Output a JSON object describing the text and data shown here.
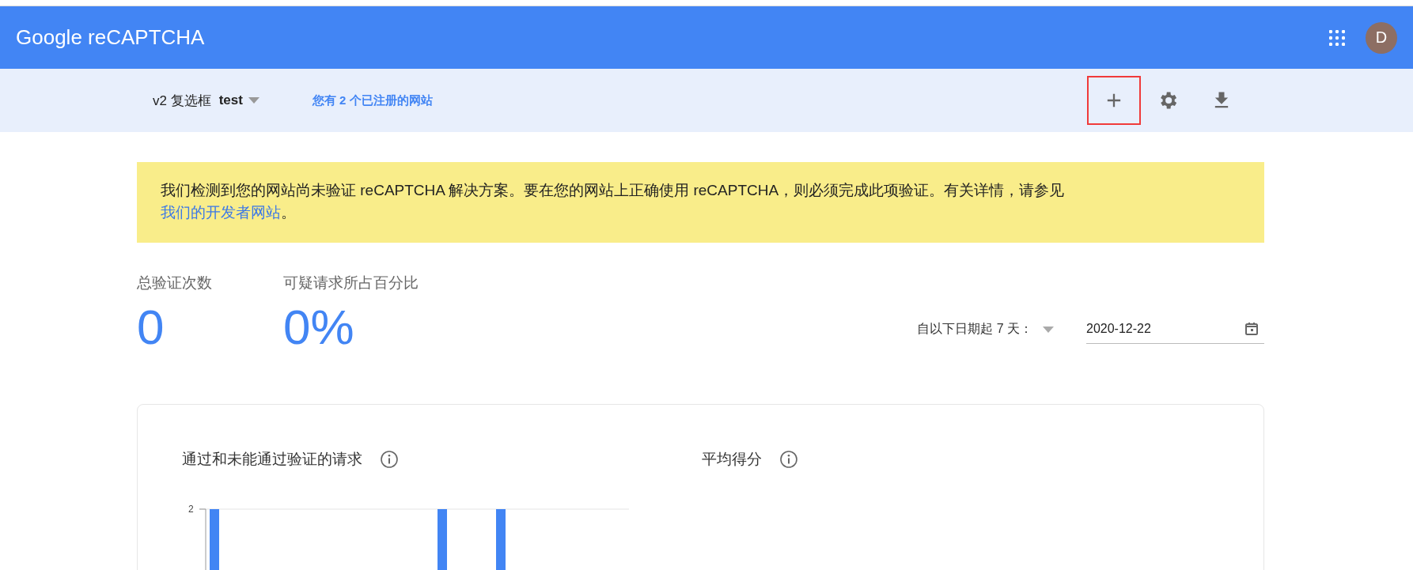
{
  "header": {
    "title": "Google reCAPTCHA",
    "avatar_letter": "D"
  },
  "subheader": {
    "key_type": "v2 复选框",
    "site": "test",
    "sites_link": "您有 2 个已注册的网站",
    "actions": [
      {
        "kind": "add",
        "highlighted": true
      },
      {
        "kind": "settings",
        "highlighted": false
      },
      {
        "kind": "download",
        "highlighted": false
      }
    ]
  },
  "banner": {
    "text": "我们检测到您的网站尚未验证 reCAPTCHA 解决方案。要在您的网站上正确使用 reCAPTCHA，则必须完成此项验证。有关详情，请参见",
    "link": "我们的开发者网站",
    "end": "。"
  },
  "stats": [
    {
      "label": "总验证次数",
      "value": "0"
    },
    {
      "label": "可疑请求所占百分比",
      "value": "0%"
    }
  ],
  "date_range": {
    "label": "自以下日期起 7 天：",
    "date": "2020-12-22"
  },
  "charts": [
    {
      "title": "通过和未能通过验证的请求",
      "tick": "2"
    },
    {
      "title": "平均得分"
    }
  ]
}
